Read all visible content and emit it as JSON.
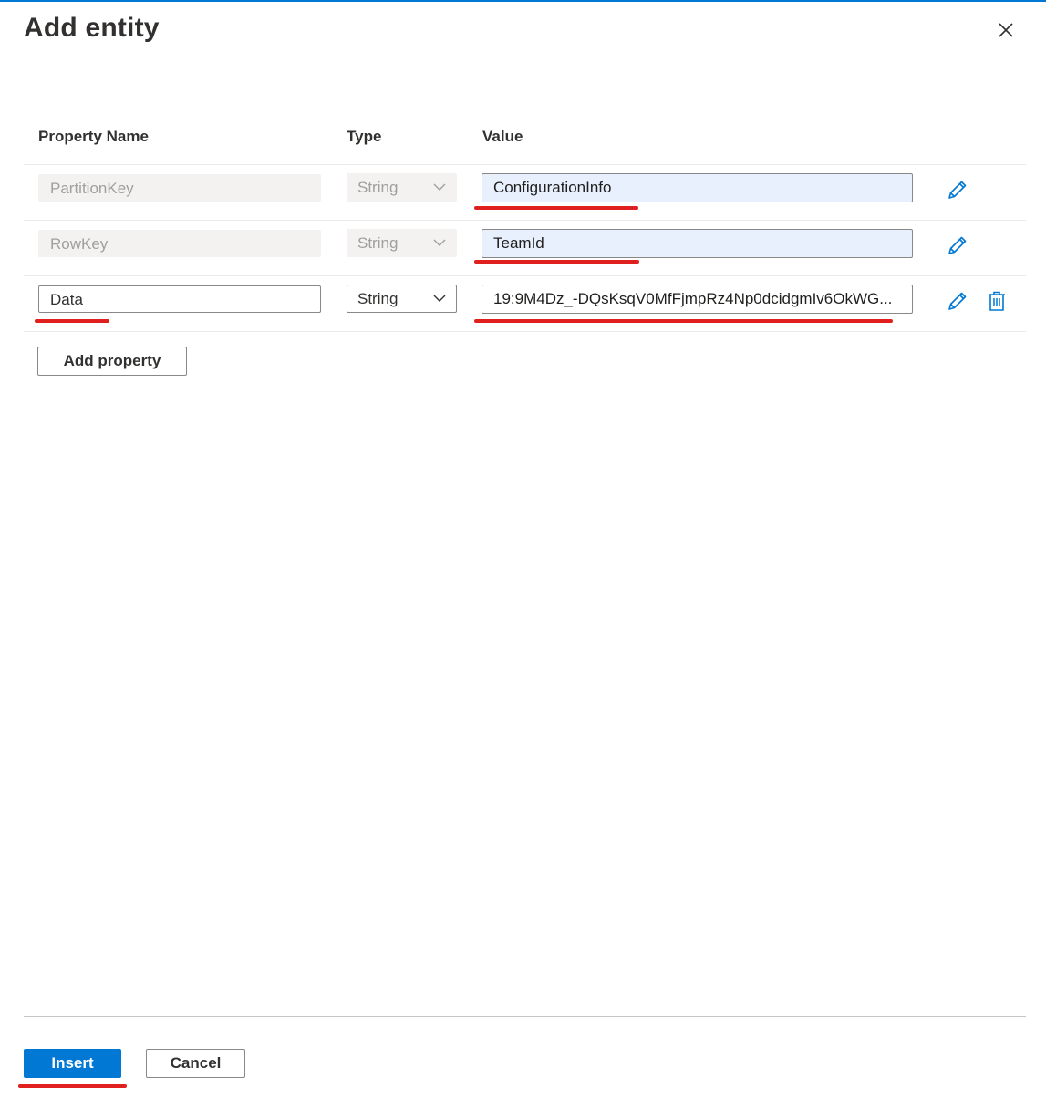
{
  "panel": {
    "title": "Add entity",
    "close_icon": "close-icon"
  },
  "table": {
    "columns": {
      "name": "Property Name",
      "type": "Type",
      "value": "Value"
    },
    "rows": [
      {
        "name": "PartitionKey",
        "type": "String",
        "value": "ConfigurationInfo",
        "name_disabled": true,
        "type_disabled": true,
        "deletable": false
      },
      {
        "name": "RowKey",
        "type": "String",
        "value": "TeamId",
        "name_disabled": true,
        "type_disabled": true,
        "deletable": false
      },
      {
        "name": "Data",
        "type": "String",
        "value": "19:9M4Dz_-DQsKsqV0MfFjmpRz4Np0dcidgmIv6OkWG...",
        "name_disabled": false,
        "type_disabled": false,
        "deletable": true
      }
    ]
  },
  "actions": {
    "add_property": "Add property",
    "insert": "Insert",
    "cancel": "Cancel"
  },
  "icons": {
    "edit": "pencil-icon",
    "delete": "trash-icon",
    "dropdown": "chevron-down-icon"
  },
  "colors": {
    "accent": "#0078d4",
    "highlight_annotation": "#e0201f",
    "autofill_bg": "#e8f0fe"
  }
}
